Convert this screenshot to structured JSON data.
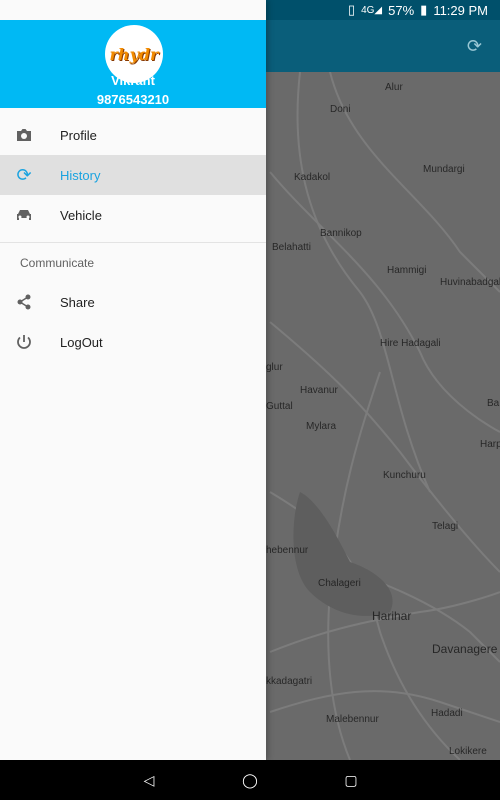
{
  "status": {
    "battery": "57%",
    "time": "11:29 PM"
  },
  "drawer": {
    "logo_text": "rhydr",
    "user_name": "Vikrant",
    "user_phone": "9876543210",
    "items": [
      {
        "label": "Profile",
        "icon": "camera-icon"
      },
      {
        "label": "History",
        "icon": "refresh-icon"
      },
      {
        "label": "Vehicle",
        "icon": "car-icon"
      }
    ],
    "section_title": "Communicate",
    "section_items": [
      {
        "label": "Share",
        "icon": "share-icon"
      },
      {
        "label": "LogOut",
        "icon": "power-icon"
      }
    ]
  },
  "map_labels": [
    "Alur",
    "Doni",
    "Mundargi",
    "Kadakol",
    "Bannikop",
    "Belahatti",
    "Hammigi",
    "Huvinabadgali",
    "Hire Hadagali",
    "glur",
    "Havanur",
    "Guttal",
    "Mylara",
    "Kunchuru",
    "Telagi",
    "hebennur",
    "Chalageri",
    "Harihar",
    "Davanagere",
    "kkadagatri",
    "Malebennur",
    "Hadadi",
    "Lokikere",
    "Harp",
    "Ba"
  ]
}
